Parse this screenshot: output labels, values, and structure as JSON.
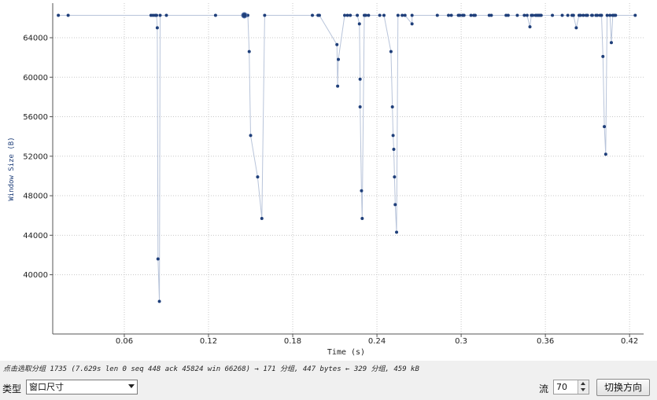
{
  "chart_data": {
    "type": "scatter",
    "xlabel": "Time (s)",
    "ylabel": "Window Size (B)",
    "xlim": [
      0.009,
      0.43
    ],
    "ylim": [
      34000,
      67500
    ],
    "xticks": [
      0.06,
      0.12,
      0.18,
      0.24,
      0.3,
      0.36,
      0.42
    ],
    "xtick_labels": [
      "0.06",
      "0.12",
      "0.18",
      "0.24",
      "0.3",
      "0.36",
      "0.42"
    ],
    "yticks": [
      40000,
      44000,
      48000,
      52000,
      56000,
      60000,
      64000
    ],
    "ytick_labels": [
      "40000",
      "44000",
      "48000",
      "52000",
      "56000",
      "60000",
      "64000"
    ],
    "grid": true,
    "line_color": "#b8c4da",
    "marker_color": "#1f3f7a",
    "highlight": {
      "x": 0.1455,
      "y": 66268
    },
    "series": [
      {
        "x": [
          0.013,
          0.02,
          0.079,
          0.0805,
          0.082,
          0.083,
          0.0835,
          0.084,
          0.085,
          0.0855,
          0.09,
          0.125,
          0.1455,
          0.148,
          0.149,
          0.15,
          0.155,
          0.158,
          0.16,
          0.194,
          0.198,
          0.199,
          0.2115,
          0.212,
          0.2125,
          0.217,
          0.219,
          0.221,
          0.226,
          0.2275,
          0.228,
          0.228,
          0.229,
          0.2295,
          0.231,
          0.232,
          0.234,
          0.242,
          0.245,
          0.25,
          0.251,
          0.2515,
          0.252,
          0.2525,
          0.253,
          0.254,
          0.255,
          0.258,
          0.26,
          0.265,
          0.265,
          0.283,
          0.291,
          0.293,
          0.298,
          0.299,
          0.301,
          0.302,
          0.307,
          0.309,
          0.31,
          0.32,
          0.3215,
          0.332,
          0.3335,
          0.34,
          0.345,
          0.347,
          0.349,
          0.35,
          0.351,
          0.353,
          0.354,
          0.355,
          0.356,
          0.357,
          0.365,
          0.372,
          0.376,
          0.379,
          0.38,
          0.382,
          0.384,
          0.385,
          0.387,
          0.389,
          0.39,
          0.393,
          0.3935,
          0.396,
          0.397,
          0.399,
          0.4,
          0.401,
          0.402,
          0.403,
          0.404,
          0.406,
          0.407,
          0.408,
          0.409,
          0.41,
          0.424
        ],
        "y": [
          66268,
          66268,
          66268,
          66268,
          66268,
          66268,
          65000,
          41600,
          37300,
          66268,
          66268,
          66268,
          66268,
          66268,
          62600,
          54100,
          49900,
          45700,
          66268,
          66268,
          66268,
          66268,
          63300,
          59100,
          61800,
          66268,
          66268,
          66268,
          66268,
          65400,
          59800,
          57000,
          48500,
          45700,
          66268,
          66268,
          66268,
          66268,
          66268,
          62600,
          57000,
          54100,
          52700,
          49900,
          47100,
          44300,
          66268,
          66268,
          66268,
          65400,
          66268,
          66268,
          66268,
          66268,
          66268,
          66268,
          66268,
          66268,
          66268,
          66268,
          66268,
          66268,
          66268,
          66268,
          66268,
          66268,
          66268,
          66268,
          65100,
          66268,
          66268,
          66268,
          66268,
          66268,
          66268,
          66268,
          66268,
          66268,
          66268,
          66268,
          66268,
          65000,
          66268,
          66268,
          66268,
          66268,
          66268,
          66268,
          66268,
          66268,
          66268,
          66268,
          66268,
          62100,
          55000,
          52200,
          66268,
          66268,
          63500,
          66268,
          66268,
          66268,
          66268
        ]
      }
    ]
  },
  "status_text": "点击选取分组 1735 (7.629s len 0 seq 448 ack 45824 win 66268) → 171 分组, 447 bytes ← 329 分组, 459 kB",
  "controls": {
    "type_label": "类型",
    "type_value": "窗口尺寸",
    "stream_label": "流",
    "stream_value": "70",
    "switch_button": "切换方向"
  }
}
